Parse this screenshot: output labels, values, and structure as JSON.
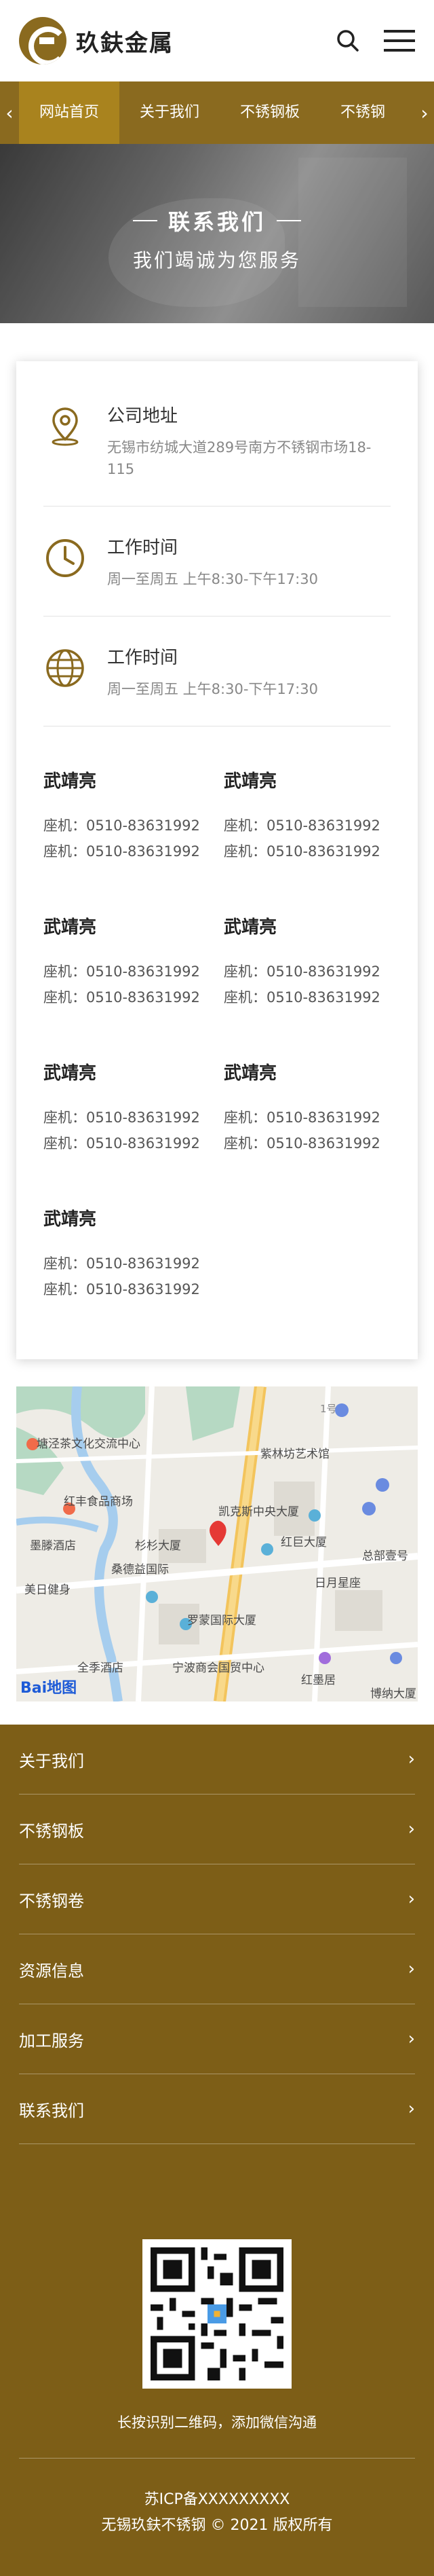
{
  "brand": {
    "name": "玖鈇金属"
  },
  "nav": {
    "items": [
      "网站首页",
      "关于我们",
      "不锈钢板",
      "不锈钢"
    ],
    "active_index": 0
  },
  "banner": {
    "title": "联系我们",
    "subtitle": "我们竭诚为您服务"
  },
  "contact": {
    "address_title": "公司地址",
    "address_text": "无锡市纺城大道289号南方不锈钢市场18-115",
    "hours1_title": "工作时间",
    "hours1_text": "周一至周五 上午8:30-下午17:30",
    "hours2_title": "工作时间",
    "hours2_text": "周一至周五 上午8:30-下午17:30",
    "persons": [
      {
        "name": "武靖亮",
        "phone1": "座机：0510-83631992",
        "phone2": "座机：0510-83631992"
      },
      {
        "name": "武靖亮",
        "phone1": "座机：0510-83631992",
        "phone2": "座机：0510-83631992"
      },
      {
        "name": "武靖亮",
        "phone1": "座机：0510-83631992",
        "phone2": "座机：0510-83631992"
      },
      {
        "name": "武靖亮",
        "phone1": "座机：0510-83631992",
        "phone2": "座机：0510-83631992"
      },
      {
        "name": "武靖亮",
        "phone1": "座机：0510-83631992",
        "phone2": "座机：0510-83631992"
      },
      {
        "name": "武靖亮",
        "phone1": "座机：0510-83631992",
        "phone2": "座机：0510-83631992"
      },
      {
        "name": "武靖亮",
        "phone1": "座机：0510-83631992",
        "phone2": "座机：0510-83631992"
      }
    ]
  },
  "map": {
    "labels": [
      "塘泾茶文化交流中心",
      "红丰食品商场",
      "杉杉大厦",
      "墨滕酒店",
      "美日健身",
      "桑德益国际",
      "凯克斯中央大厦",
      "紫林坊艺术馆",
      "红巨大厦",
      "总部壹号",
      "日月星座",
      "罗蒙国际大厦",
      "全季酒店",
      "宁波商会国贸中心",
      "红墨居",
      "博纳大厦"
    ],
    "road_label": "1号",
    "logo_text": "Bai",
    "logo_suffix": "地图"
  },
  "footer": {
    "menu": [
      "关于我们",
      "不锈钢板",
      "不锈钢卷",
      "资源信息",
      "加工服务",
      "联系我们"
    ],
    "qr_caption": "长按识别二维码，添加微信沟通",
    "icp": "苏ICP备XXXXXXXXX",
    "copyright": "无锡玖鈇不锈钢 © 2021 版权所有"
  },
  "colors": {
    "brand_gold": "#8a6a1f",
    "nav_active": "#a9831e",
    "footer_bg": "#7d5e17"
  },
  "icons": {
    "location": "location-pin-icon",
    "clock": "clock-icon",
    "globe": "globe-icon",
    "search": "search-icon",
    "menu": "hamburger-menu-icon"
  }
}
